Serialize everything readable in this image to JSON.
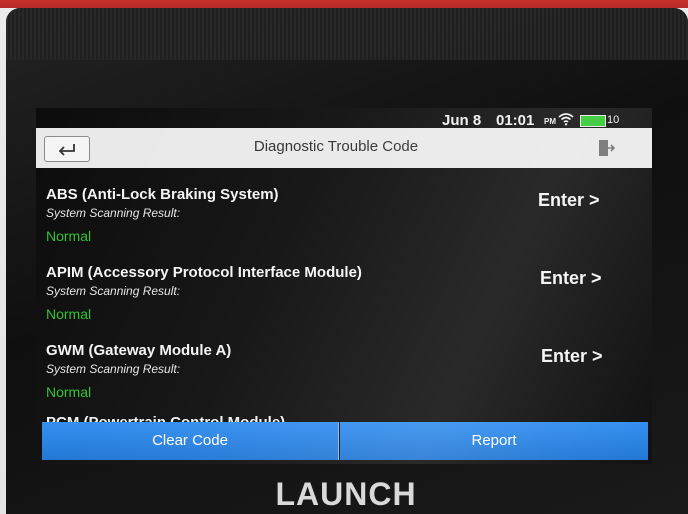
{
  "device": {
    "brand": "LAUNCH"
  },
  "status_bar": {
    "date": "Jun 8",
    "time": "01:01",
    "ampm": "PM",
    "battery_text": "10",
    "battery_color": "#2dc82d"
  },
  "header": {
    "title": "Diagnostic Trouble Code",
    "back_icon": "back-arrow-icon",
    "exit_icon": "exit-icon"
  },
  "modules": [
    {
      "name": "ABS (Anti-Lock Braking System)",
      "scan_label": "System Scanning Result:",
      "result": "Normal",
      "enter_label": "Enter >"
    },
    {
      "name": "APIM (Accessory Protocol Interface Module)",
      "scan_label": "System Scanning Result:",
      "result": "Normal",
      "enter_label": "Enter >"
    },
    {
      "name": "GWM (Gateway Module A)",
      "scan_label": "System Scanning Result:",
      "result": "Normal",
      "enter_label": "Enter >"
    }
  ],
  "partial_module": {
    "name": "PCM (Powertrain Control Module)"
  },
  "footer": {
    "clear_code_label": "Clear Code",
    "report_label": "Report",
    "accent_color": "#1d74d3"
  },
  "colors": {
    "result_normal": "#2fc12f",
    "screen_background": "#0c0c0c",
    "title_bar": "#e9e9e9"
  }
}
